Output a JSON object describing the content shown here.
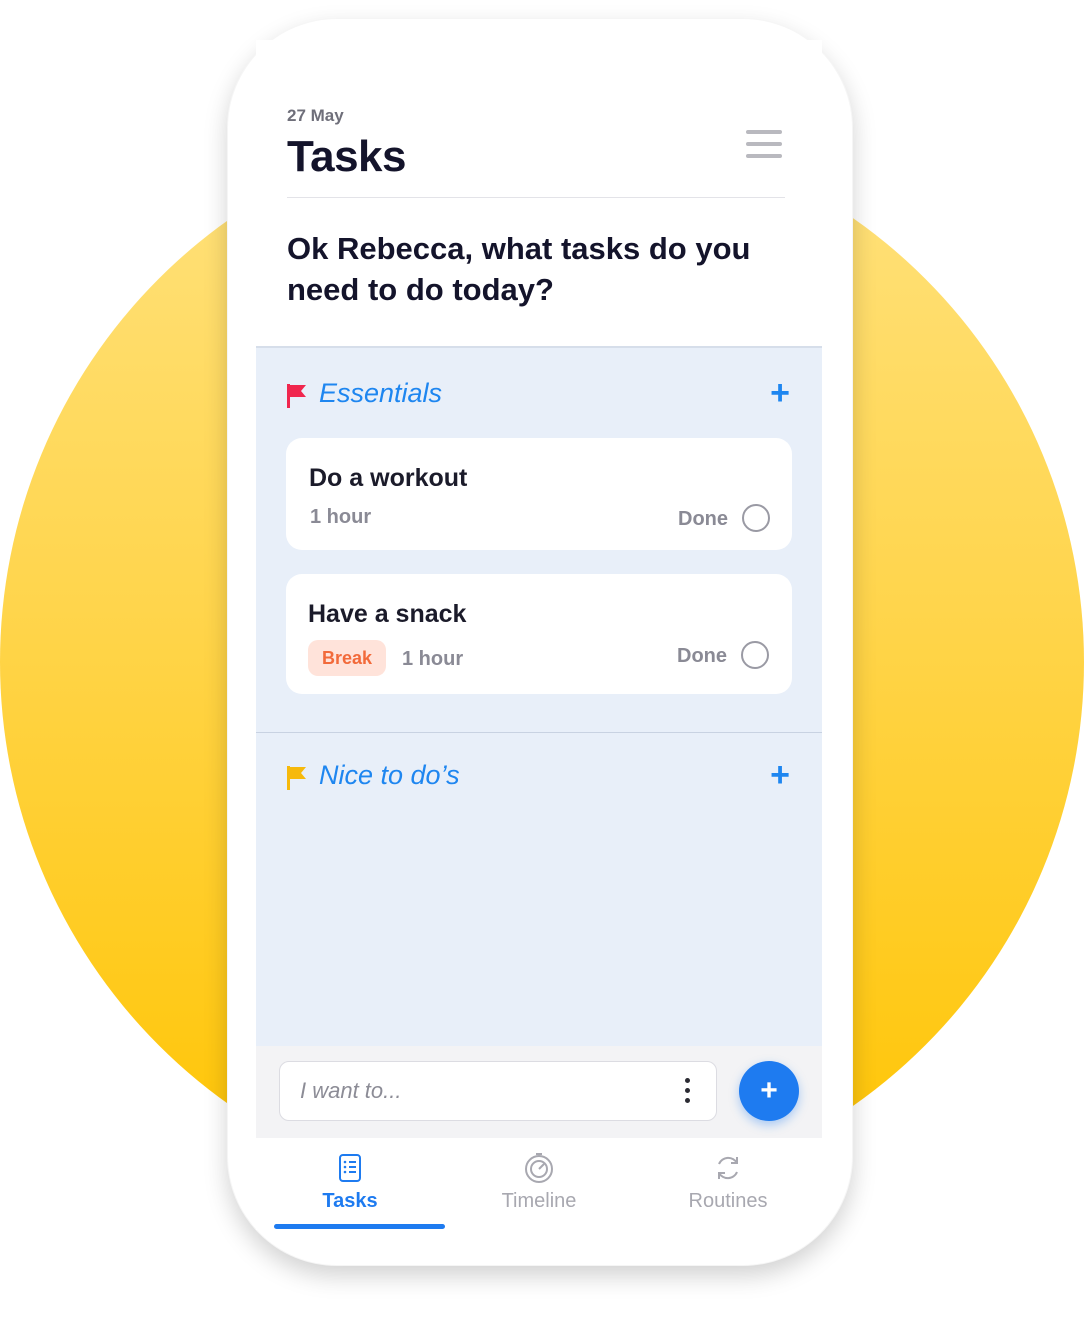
{
  "header": {
    "date": "27 May",
    "title": "Tasks"
  },
  "prompt": "Ok Rebecca, what tasks do you need to do today?",
  "sections": [
    {
      "label": "Essentials",
      "flag_color": "#F0264E",
      "tasks": [
        {
          "title": "Do a workout",
          "duration": "1 hour",
          "done_label": "Done"
        },
        {
          "title": "Have a snack",
          "tag": "Break",
          "duration": "1 hour",
          "done_label": "Done"
        }
      ]
    },
    {
      "label": "Nice to do’s",
      "flag_color": "#F6B90C",
      "tasks": []
    }
  ],
  "input": {
    "placeholder": "I want to..."
  },
  "tabs": [
    {
      "label": "Tasks",
      "icon": "tasks-list-icon",
      "active": true
    },
    {
      "label": "Timeline",
      "icon": "timeline-gauge-icon",
      "active": false
    },
    {
      "label": "Routines",
      "icon": "routines-refresh-icon",
      "active": false
    }
  ],
  "colors": {
    "accent": "#1E7BF0",
    "background_circle": "#FFD54C",
    "list_background": "#E8EFF9",
    "badge_text": "#F26A3A",
    "badge_bg": "#FFE3DA"
  }
}
